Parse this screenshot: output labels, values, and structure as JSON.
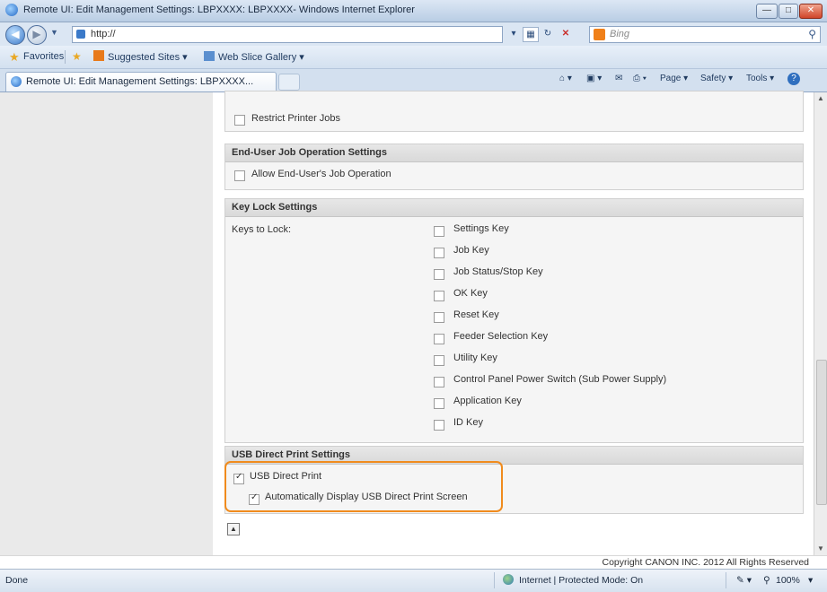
{
  "window": {
    "title": "Remote UI: Edit Management Settings: LBPXXXX: LBPXXXX- Windows Internet Explorer",
    "minimize": "—",
    "maximize": "□",
    "close": "✕"
  },
  "address_bar": {
    "url": "http://",
    "search_placeholder": "Bing"
  },
  "favorites_bar": {
    "favorites_label": "Favorites",
    "suggested_sites": "Suggested Sites ▾",
    "web_slice_gallery": "Web Slice Gallery ▾"
  },
  "tab": {
    "title": "Remote UI: Edit Management Settings: LBPXXXX..."
  },
  "command_bar": {
    "page": "Page ▾",
    "safety": "Safety ▾",
    "tools": "Tools ▾",
    "help": "?"
  },
  "page": {
    "restrict_printer_jobs": {
      "label": "Restrict Printer Jobs",
      "checked": false
    },
    "end_user_section": {
      "heading": "End-User Job Operation Settings",
      "allow_label": "Allow End-User's Job Operation",
      "allow_checked": false
    },
    "key_lock_section": {
      "heading": "Key Lock Settings",
      "keys_to_lock_label": "Keys to Lock:",
      "keys": [
        {
          "label": "Settings Key",
          "checked": false
        },
        {
          "label": "Job Key",
          "checked": false
        },
        {
          "label": "Job Status/Stop Key",
          "checked": false
        },
        {
          "label": "OK Key",
          "checked": false
        },
        {
          "label": "Reset Key",
          "checked": false
        },
        {
          "label": "Feeder Selection Key",
          "checked": false
        },
        {
          "label": "Utility Key",
          "checked": false
        },
        {
          "label": "Control Panel Power Switch (Sub Power Supply)",
          "checked": false
        },
        {
          "label": "Application Key",
          "checked": false
        },
        {
          "label": "ID Key",
          "checked": false
        }
      ]
    },
    "usb_section": {
      "heading": "USB Direct Print Settings",
      "usb_direct_print_label": "USB Direct Print",
      "usb_direct_print_checked": true,
      "auto_display_label": "Automatically Display USB Direct Print Screen",
      "auto_display_checked": true
    },
    "copyright": "Copyright CANON INC. 2012 All Rights Reserved"
  },
  "status_bar": {
    "left_text": "Done",
    "zone_text": "Internet | Protected Mode: On",
    "zoom": "100%"
  },
  "colors": {
    "highlight": "#f08b1d",
    "section_header": "#dedede",
    "chrome": "#d3e0ef"
  }
}
